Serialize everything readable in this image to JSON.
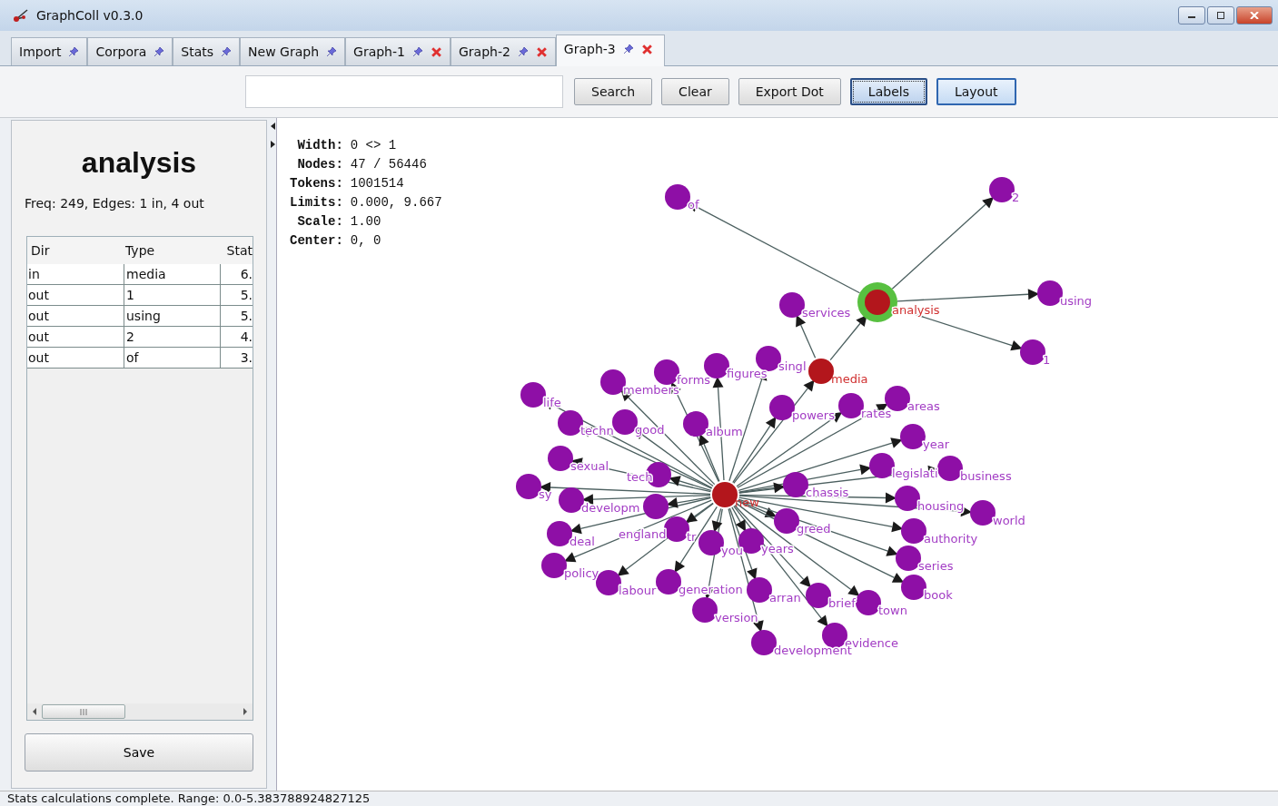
{
  "window": {
    "title": "GraphColl v0.3.0"
  },
  "tabs": [
    {
      "label": "Import",
      "closable": false,
      "selected": false
    },
    {
      "label": "Corpora",
      "closable": false,
      "selected": false
    },
    {
      "label": "Stats",
      "closable": false,
      "selected": false
    },
    {
      "label": "New Graph",
      "closable": false,
      "selected": false
    },
    {
      "label": "Graph-1",
      "closable": true,
      "selected": false
    },
    {
      "label": "Graph-2",
      "closable": true,
      "selected": false
    },
    {
      "label": "Graph-3",
      "closable": true,
      "selected": true
    }
  ],
  "toolbar": {
    "buttons": [
      {
        "label": "Search",
        "focused": false,
        "hovered": false
      },
      {
        "label": "Clear",
        "focused": false,
        "hovered": false
      },
      {
        "label": "Export Dot",
        "focused": false,
        "hovered": false
      },
      {
        "label": "Labels",
        "focused": true,
        "hovered": false
      },
      {
        "label": "Layout",
        "focused": false,
        "hovered": true
      }
    ]
  },
  "side_panel": {
    "heading": "analysis",
    "summary": "Freq: 249, Edges: 1 in, 4 out",
    "table": {
      "columns": [
        "Dir",
        "Type",
        "Stat"
      ],
      "rows": [
        [
          "in",
          "media",
          "6."
        ],
        [
          "out",
          "1",
          "5."
        ],
        [
          "out",
          "using",
          "5."
        ],
        [
          "out",
          "2",
          "4."
        ],
        [
          "out",
          "of",
          "3."
        ]
      ]
    },
    "save_button": "Save"
  },
  "graph": {
    "info": [
      {
        "label": "Width:",
        "value": "0 <> 1"
      },
      {
        "label": "Nodes:",
        "value": "47 / 56446"
      },
      {
        "label": "Tokens:",
        "value": "1001514"
      },
      {
        "label": "Limits:",
        "value": "0.000, 9.667"
      },
      {
        "label": "Scale:",
        "value": "1.00"
      },
      {
        "label": "Center:",
        "value": "0, 0"
      }
    ],
    "nodes": [
      {
        "label": "new",
        "kind": "hub"
      },
      {
        "label": "media",
        "kind": "hub"
      },
      {
        "label": "analysis",
        "kind": "focus"
      },
      {
        "label": "of",
        "kind": "word"
      },
      {
        "label": "2",
        "kind": "word"
      },
      {
        "label": "using",
        "kind": "word"
      },
      {
        "label": "1",
        "kind": "word"
      },
      {
        "label": "services",
        "kind": "word"
      },
      {
        "label": "singl",
        "kind": "word"
      },
      {
        "label": "figures",
        "kind": "word"
      },
      {
        "label": "forms",
        "kind": "word"
      },
      {
        "label": "members",
        "kind": "word"
      },
      {
        "label": "life",
        "kind": "word"
      },
      {
        "label": "techn",
        "kind": "word"
      },
      {
        "label": "good",
        "kind": "word"
      },
      {
        "label": "album",
        "kind": "word"
      },
      {
        "label": "powers",
        "kind": "word"
      },
      {
        "label": "rates",
        "kind": "word"
      },
      {
        "label": "areas",
        "kind": "word"
      },
      {
        "label": "year",
        "kind": "word"
      },
      {
        "label": "legislati",
        "kind": "word"
      },
      {
        "label": "business",
        "kind": "word"
      },
      {
        "label": "chassis",
        "kind": "word"
      },
      {
        "label": "housing",
        "kind": "word"
      },
      {
        "label": "world",
        "kind": "word"
      },
      {
        "label": "authority",
        "kind": "word"
      },
      {
        "label": "greed",
        "kind": "word"
      },
      {
        "label": "series",
        "kind": "word"
      },
      {
        "label": "book",
        "kind": "word"
      },
      {
        "label": "town",
        "kind": "word"
      },
      {
        "label": "evidence",
        "kind": "word"
      },
      {
        "label": "brief",
        "kind": "word"
      },
      {
        "label": "arran",
        "kind": "word"
      },
      {
        "label": "development",
        "kind": "word"
      },
      {
        "label": "generation",
        "kind": "word"
      },
      {
        "label": "version",
        "kind": "word"
      },
      {
        "label": "labour",
        "kind": "word"
      },
      {
        "label": "deal",
        "kind": "word"
      },
      {
        "label": "policy",
        "kind": "word"
      },
      {
        "label": "years",
        "kind": "word"
      },
      {
        "label": "you",
        "kind": "word"
      },
      {
        "label": "england",
        "kind": "word"
      },
      {
        "label": "tr",
        "kind": "word"
      },
      {
        "label": "developm",
        "kind": "word"
      },
      {
        "label": "sy",
        "kind": "word"
      },
      {
        "label": "sexual",
        "kind": "word"
      },
      {
        "label": "tech",
        "kind": "word"
      }
    ]
  },
  "status_bar": "Stats calculations complete.  Range: 0.0-5.383788924827125"
}
